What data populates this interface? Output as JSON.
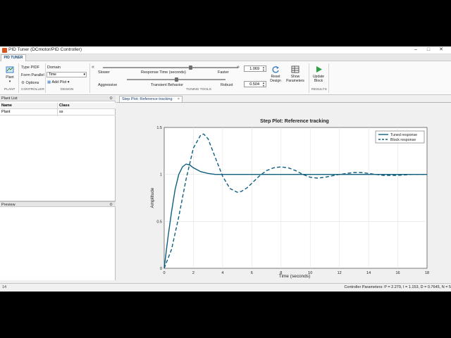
{
  "window": {
    "title": "PID Tuner (DCmotor/PID Controller)",
    "min": "–",
    "max": "□",
    "close": "✕"
  },
  "toolstrip": {
    "tab": "PID TUNER"
  },
  "plant_group": {
    "plant_button": "Plant",
    "plant_section": "PLANT",
    "type_label": "Type PIDF",
    "form_label": "Form Parallel",
    "options_label": "Options",
    "controller_section": "CONTROLLER"
  },
  "design_group": {
    "domain_label": "Domain",
    "domain_value": "Time",
    "add_plot_label": "Add Plot",
    "section": "DESIGN"
  },
  "tuning": {
    "response_slow": "Slower",
    "response_label": "Response Time (seconds)",
    "response_fast": "Faster",
    "response_value": "1.069",
    "response_level": 0.65,
    "behavior_aggr": "Aggressive",
    "behavior_label": "Transient Behavior",
    "behavior_robust": "Robust",
    "behavior_value": "0.504",
    "behavior_level": 0.5,
    "collapse": "«",
    "expand": "»",
    "reset_label": "Reset\nDesign",
    "show_params_label": "Show\nParameters",
    "section": "TUNING TOOLS"
  },
  "results": {
    "update_label": "Update\nBlock",
    "section": "RESULTS"
  },
  "plant_list": {
    "title": "Plant List",
    "columns": [
      "Name",
      "Class"
    ],
    "rows": [
      {
        "name": "Plant",
        "class": "ss"
      }
    ]
  },
  "preview": {
    "title": "Preview"
  },
  "doc_tab": {
    "label": "Step Plot: Reference tracking",
    "close": "×"
  },
  "status": {
    "left": "14",
    "right": "Controller Parameters: P = 2.279, I = 1.153, D = 0.7645, N = 5"
  },
  "colors": {
    "accent": "#1f6fb2",
    "tuned": "#0e5f7f",
    "block": "#0e5f7f"
  },
  "chart_data": {
    "type": "line",
    "title": "Step Plot: Reference tracking",
    "xlabel": "Time (seconds)",
    "ylabel": "Amplitude",
    "xlim": [
      0,
      18
    ],
    "ylim": [
      0,
      1.5
    ],
    "xticks": [
      0,
      2,
      4,
      6,
      8,
      10,
      12,
      14,
      16,
      18
    ],
    "yticks": [
      0,
      0.5,
      1,
      1.5
    ],
    "ytick_labels": [
      "0",
      "0.5",
      "1",
      "1.5"
    ],
    "grid": true,
    "legend_position": "top-right",
    "series": [
      {
        "name": "Tuned response",
        "style": "solid",
        "x": [
          0,
          0.25,
          0.5,
          0.75,
          1.0,
          1.25,
          1.5,
          1.75,
          2.0,
          2.5,
          3.0,
          3.5,
          4.0,
          5.0,
          6.0,
          8.0,
          10.0,
          14.0,
          18.0
        ],
        "y": [
          0,
          0.32,
          0.6,
          0.84,
          1.0,
          1.08,
          1.11,
          1.1,
          1.07,
          1.03,
          1.01,
          1.0,
          1.0,
          1.0,
          1.0,
          1.0,
          1.0,
          1.0,
          1.0
        ]
      },
      {
        "name": "Block response",
        "style": "dashed",
        "x": [
          0,
          0.5,
          1.0,
          1.5,
          2.0,
          2.5,
          2.7,
          3.0,
          3.5,
          4.0,
          4.5,
          5.0,
          5.3,
          5.7,
          6.5,
          7.0,
          7.5,
          8.0,
          8.5,
          9.0,
          9.5,
          10.0,
          10.5,
          11.0,
          12.0,
          12.5,
          13.0,
          13.5,
          14.0,
          14.5,
          15.0,
          16.0,
          17.0,
          18.0
        ],
        "y": [
          0,
          0.2,
          0.55,
          0.95,
          1.28,
          1.42,
          1.43,
          1.38,
          1.18,
          0.98,
          0.85,
          0.81,
          0.82,
          0.86,
          0.98,
          1.04,
          1.07,
          1.08,
          1.07,
          1.04,
          1.0,
          0.97,
          0.96,
          0.97,
          1.0,
          1.01,
          1.02,
          1.02,
          1.01,
          1.0,
          0.99,
          0.99,
          1.0,
          1.0
        ]
      }
    ]
  }
}
